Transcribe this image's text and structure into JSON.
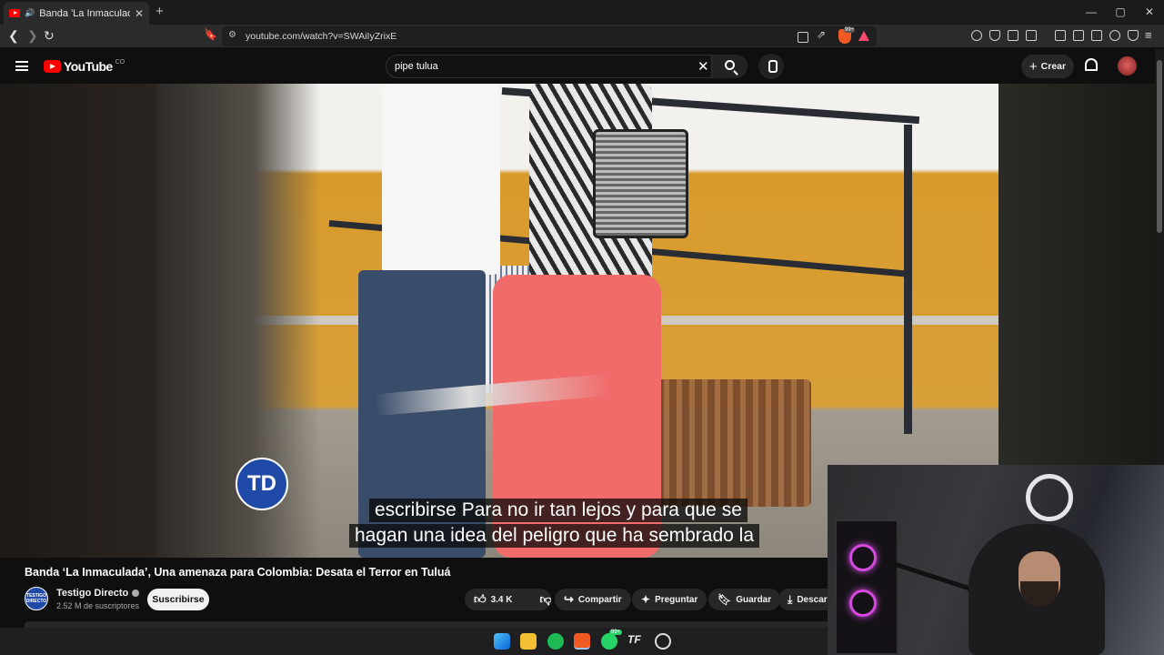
{
  "browser": {
    "tab_title": "Banda 'La Inmaculada', Una a",
    "url": "youtube.com/watch?v=SWAiIyZrixE",
    "window_controls": [
      "—",
      "▢",
      "✕"
    ],
    "new_tab_label": "+",
    "shield_badge": "99+"
  },
  "youtube": {
    "logo_text": "YouTube",
    "country_code": "CO",
    "search_value": "pipe tulua",
    "create_label": "Crear"
  },
  "video": {
    "badge_text": "TD",
    "captions": [
      "escribirse Para no ir tan lejos y para que se",
      "hagan una idea del peligro que ha sembrado la"
    ]
  },
  "meta": {
    "title": "Banda ‘La Inmaculada’, Una amenaza para Colombia: Desata el Terror en Tuluá",
    "channel_name": "Testigo Directo",
    "channel_avatar_text": "TESTIGO DIRECTO",
    "subscribers": "2.52 M de suscriptores",
    "subscribe_label": "Suscribirse",
    "likes": "3.4 K",
    "share_label": "Compartir",
    "ask_label": "Preguntar",
    "save_label": "Guardar",
    "download_label": "Descargar"
  },
  "taskbar": {
    "whatsapp_badge": "99+"
  },
  "colors": {
    "yt_red": "#ff0000",
    "brave_orange": "#f25a23",
    "td_blue": "#1f4aa8",
    "pants_coral": "#f06b69",
    "rgb_purple": "#d54adf"
  },
  "icons": [
    "back-icon",
    "forward-icon",
    "reload-icon",
    "bookmark-icon",
    "site-info-icon",
    "cast-icon",
    "share-icon",
    "brave-shields-icon",
    "brave-rewards-icon",
    "hamburger-icon",
    "search-icon",
    "clear-icon",
    "mic-icon",
    "plus-icon",
    "bell-icon",
    "like-icon",
    "dislike-icon",
    "share-arrow-icon",
    "sparkle-icon",
    "bookmark-save-icon",
    "download-icon"
  ]
}
